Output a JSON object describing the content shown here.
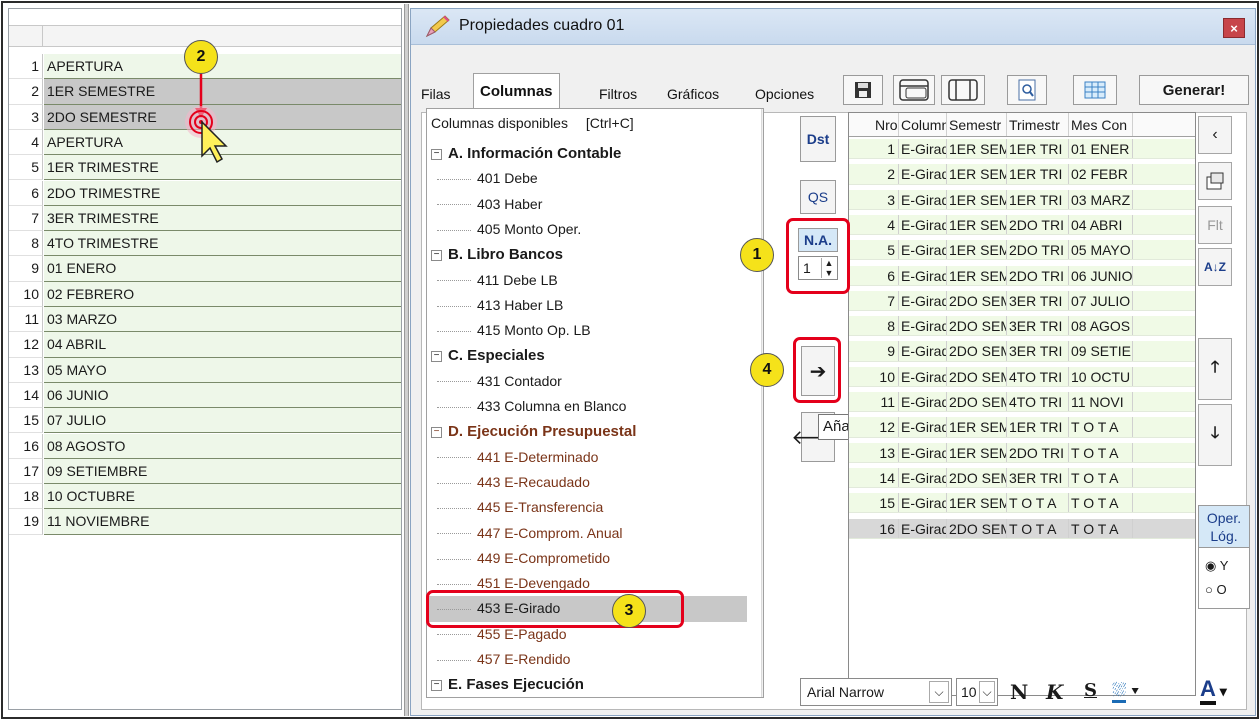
{
  "left_list": {
    "rows": [
      {
        "n": "1",
        "label": "APERTURA",
        "selected": false
      },
      {
        "n": "2",
        "label": "1ER SEMESTRE",
        "selected": true
      },
      {
        "n": "3",
        "label": "2DO SEMESTRE",
        "selected": true
      },
      {
        "n": "4",
        "label": "APERTURA",
        "selected": false
      },
      {
        "n": "5",
        "label": "1ER TRIMESTRE",
        "selected": false
      },
      {
        "n": "6",
        "label": "2DO TRIMESTRE",
        "selected": false
      },
      {
        "n": "7",
        "label": "3ER TRIMESTRE",
        "selected": false
      },
      {
        "n": "8",
        "label": "4TO TRIMESTRE",
        "selected": false
      },
      {
        "n": "9",
        "label": "01 ENERO",
        "selected": false
      },
      {
        "n": "10",
        "label": "02 FEBRERO",
        "selected": false
      },
      {
        "n": "11",
        "label": "03 MARZO",
        "selected": false
      },
      {
        "n": "12",
        "label": "04 ABRIL",
        "selected": false
      },
      {
        "n": "13",
        "label": "05 MAYO",
        "selected": false
      },
      {
        "n": "14",
        "label": "06 JUNIO",
        "selected": false
      },
      {
        "n": "15",
        "label": "07 JULIO",
        "selected": false
      },
      {
        "n": "16",
        "label": "08 AGOSTO",
        "selected": false
      },
      {
        "n": "17",
        "label": "09 SETIEMBRE",
        "selected": false
      },
      {
        "n": "18",
        "label": "10 OCTUBRE",
        "selected": false
      },
      {
        "n": "19",
        "label": "11 NOVIEMBRE",
        "selected": false
      }
    ]
  },
  "dialog": {
    "title": "Propiedades cuadro 01",
    "close": "×",
    "tabs": [
      "Filas",
      "Columnas",
      "Filtros",
      "Gráficos",
      "Opciones"
    ],
    "active_tab": "Columnas",
    "generar": "Generar!"
  },
  "available": {
    "header": "Columnas disponibles",
    "shortcut": "[Ctrl+C]",
    "items": [
      {
        "type": "group",
        "label": "A. Información Contable"
      },
      {
        "type": "item",
        "label": "401 Debe",
        "style": "normal"
      },
      {
        "type": "item",
        "label": "403 Haber",
        "style": "normal"
      },
      {
        "type": "item",
        "label": "405 Monto Oper.",
        "style": "normal"
      },
      {
        "type": "group",
        "label": "B. Libro Bancos"
      },
      {
        "type": "item",
        "label": "411 Debe LB",
        "style": "normal"
      },
      {
        "type": "item",
        "label": "413 Haber LB",
        "style": "normal"
      },
      {
        "type": "item",
        "label": "415 Monto Op. LB",
        "style": "normal"
      },
      {
        "type": "group",
        "label": "C. Especiales"
      },
      {
        "type": "item",
        "label": "431 Contador",
        "style": "normal"
      },
      {
        "type": "item",
        "label": "433 Columna en Blanco",
        "style": "normal"
      },
      {
        "type": "group",
        "label": "D. Ejecución Presupuestal",
        "style": "red"
      },
      {
        "type": "item",
        "label": "441 E-Determinado",
        "style": "red"
      },
      {
        "type": "item",
        "label": "443 E-Recaudado",
        "style": "red"
      },
      {
        "type": "item",
        "label": "445 E-Transferencia",
        "style": "red"
      },
      {
        "type": "item",
        "label": "447 E-Comprom. Anual",
        "style": "red"
      },
      {
        "type": "item",
        "label": "449 E-Comprometido",
        "style": "red"
      },
      {
        "type": "item",
        "label": "451 E-Devengado",
        "style": "red"
      },
      {
        "type": "item",
        "label": "453 E-Girado",
        "style": "normal",
        "selected": true
      },
      {
        "type": "item",
        "label": "455 E-Pagado",
        "style": "red"
      },
      {
        "type": "item",
        "label": "457 E-Rendido",
        "style": "red"
      },
      {
        "type": "group",
        "label": "E. Fases Ejecución"
      }
    ]
  },
  "middle_buttons": {
    "dst": "Dst",
    "qs": "QS",
    "na": "N.A.",
    "na_value": "1",
    "add_arrow": "➔",
    "tooltip": "Añadir Columna"
  },
  "grid": {
    "headers": [
      "Nro",
      "Columna",
      "Semestr",
      "Trimestr",
      "Mes Con"
    ],
    "rows": [
      [
        "1",
        "E-Girado",
        "1ER SEM",
        "1ER TRI",
        "01 ENER"
      ],
      [
        "2",
        "E-Girado",
        "1ER SEM",
        "1ER TRI",
        "02 FEBR"
      ],
      [
        "3",
        "E-Girado",
        "1ER SEM",
        "1ER TRI",
        "03 MARZ"
      ],
      [
        "4",
        "E-Girado",
        "1ER SEM",
        "2DO TRI",
        "04 ABRI"
      ],
      [
        "5",
        "E-Girado",
        "1ER SEM",
        "2DO TRI",
        "05 MAYO"
      ],
      [
        "6",
        "E-Girado",
        "1ER SEM",
        "2DO TRI",
        "06 JUNIO"
      ],
      [
        "7",
        "E-Girado",
        "2DO SEM",
        "3ER TRI",
        "07 JULIO"
      ],
      [
        "8",
        "E-Girado",
        "2DO SEM",
        "3ER TRI",
        "08 AGOS"
      ],
      [
        "9",
        "E-Girado",
        "2DO SEM",
        "3ER TRI",
        "09 SETIE"
      ],
      [
        "10",
        "E-Girado",
        "2DO SEM",
        "4TO TRI",
        "10 OCTU"
      ],
      [
        "11",
        "E-Girado",
        "2DO SEM",
        "4TO TRI",
        "11 NOVI"
      ],
      [
        "12",
        "E-Girado",
        "1ER SEM",
        "1ER TRI",
        "T O T A"
      ],
      [
        "13",
        "E-Girado",
        "1ER SEM",
        "2DO TRI",
        "T O T A"
      ],
      [
        "14",
        "E-Girado",
        "2DO SEM",
        "3ER TRI",
        "T O T A"
      ],
      [
        "15",
        "E-Girado",
        "1ER SEM",
        "T O T A",
        "T O T A"
      ],
      [
        "16",
        "E-Girado",
        "2DO SEM",
        "T O T A",
        "T O T A"
      ]
    ],
    "selected_row": 16
  },
  "right_buttons": {
    "flt": "Flt",
    "az": "A↓Z",
    "oper": "Oper. Lóg.",
    "opt_y": "Y",
    "opt_o": "O"
  },
  "bottom": {
    "font": "Arial Narrow",
    "size": "10",
    "bold": "N",
    "italic": "K",
    "strike": "S",
    "color_a": "A"
  },
  "callouts": [
    "1",
    "2",
    "3",
    "4"
  ],
  "colors": {
    "accent_red": "#e4001b",
    "callout_yellow": "#f5e21a",
    "row_green": "#eef7e9",
    "red_text": "#7a3418"
  }
}
